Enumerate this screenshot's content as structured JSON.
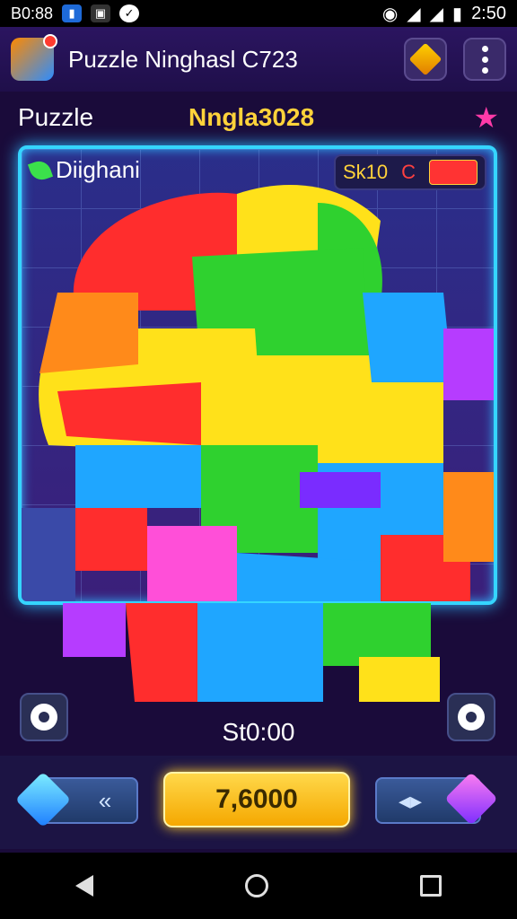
{
  "status_bar": {
    "left_text": "B0:88",
    "time": "2:50",
    "icons": [
      "notification-app-icon",
      "gallery-icon",
      "check-icon",
      "wifi-icon",
      "signal-icon",
      "signal-icon",
      "battery-icon"
    ]
  },
  "app_bar": {
    "title": "Puzzle Ninghasl C723",
    "logo_icon": "puzzle-logo-icon",
    "right_icons": [
      "gem-shop-icon",
      "more-vert-icon"
    ]
  },
  "header": {
    "left_label": "Puzzle",
    "center_label": "Nngla3028",
    "right_icon": "star-icon"
  },
  "board": {
    "title": "Diighani",
    "score_label": "Sk10",
    "score_mark": "C",
    "piece_colors": [
      "#ff2d2d",
      "#ffe11a",
      "#2fd12f",
      "#1fa6ff",
      "#b63cff",
      "#ff8a1a",
      "#7a2cff"
    ]
  },
  "timer": "St0:00",
  "bottom": {
    "left_button_glyph": "«",
    "center_value": "7,6000",
    "right_button_glyph": "◂▸"
  },
  "colors": {
    "accent_yellow": "#ffd23a",
    "board_border": "#35d5ff",
    "background": "#1a0b3a"
  }
}
